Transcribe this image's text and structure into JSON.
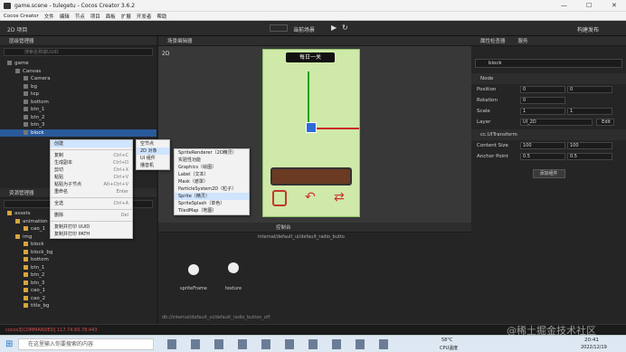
{
  "window": {
    "title": "game.scene - tulegetu - Cocos Creator 3.6.2"
  },
  "menubar": [
    "Cocos Creator",
    "文件",
    "编辑",
    "节点",
    "项目",
    "面板",
    "扩展",
    "开发者",
    "帮助"
  ],
  "toolbar": {
    "mode": "2D 项目",
    "scene_select": "当前场景",
    "build": "构建发布"
  },
  "hierarchy": {
    "title": "层级管理器",
    "search_placeholder": "搜索名称或UUID",
    "items": [
      {
        "label": "game",
        "d": 0
      },
      {
        "label": "Canvas",
        "d": 1
      },
      {
        "label": "Camera",
        "d": 2
      },
      {
        "label": "bg",
        "d": 2
      },
      {
        "label": "top",
        "d": 2
      },
      {
        "label": "bottom",
        "d": 2
      },
      {
        "label": "btn_1",
        "d": 2
      },
      {
        "label": "btn_2",
        "d": 2
      },
      {
        "label": "btn_3",
        "d": 2
      },
      {
        "label": "block",
        "d": 2,
        "selected": true
      }
    ]
  },
  "scene_editor": {
    "title": "场景编辑器",
    "mode": "2D",
    "header_text": "每日一关"
  },
  "assets": {
    "title": "资源管理器",
    "items": [
      {
        "label": "assets",
        "d": 0
      },
      {
        "label": "animation",
        "d": 1
      },
      {
        "label": "cao_1",
        "d": 2
      },
      {
        "label": "img",
        "d": 1
      },
      {
        "label": "block",
        "d": 2
      },
      {
        "label": "block_bg",
        "d": 2
      },
      {
        "label": "bottom",
        "d": 2
      },
      {
        "label": "btn_1",
        "d": 2
      },
      {
        "label": "btn_2",
        "d": 2
      },
      {
        "label": "btn_3",
        "d": 2
      },
      {
        "label": "cao_1",
        "d": 2
      },
      {
        "label": "cao_2",
        "d": 2
      },
      {
        "label": "title_bg",
        "d": 2
      }
    ]
  },
  "context_menu": {
    "items": [
      {
        "label": "创建",
        "key": ""
      },
      {
        "sep": true
      },
      {
        "label": "复制",
        "key": "Ctrl+C"
      },
      {
        "label": "生成副本",
        "key": "Ctrl+D"
      },
      {
        "label": "剪切",
        "key": "Ctrl+X"
      },
      {
        "label": "粘贴",
        "key": "Ctrl+V"
      },
      {
        "label": "粘贴为子节点",
        "key": "Alt+Ctrl+V"
      },
      {
        "label": "重命名",
        "key": "Enter"
      },
      {
        "sep": true
      },
      {
        "label": "全选",
        "key": "Ctrl+A"
      },
      {
        "sep": true
      },
      {
        "label": "删除",
        "key": "Del"
      },
      {
        "sep": true
      },
      {
        "label": "复制并打印 UUID",
        "key": ""
      },
      {
        "label": "复制并打印 PATH",
        "key": ""
      }
    ]
  },
  "submenu1": [
    "空节点",
    "2D 对象",
    "UI 组件",
    "播音机"
  ],
  "submenu2": [
    "SpriteRenderer（2D精灵）",
    "实验性功能",
    "Graphics（绘图）",
    "Label（文本）",
    "Mask（遮罩）",
    "ParticleSystem2D（粒子）",
    "Sprite（精灵）",
    "SpriteSplash（单色）",
    "TiledMap（地图）"
  ],
  "bottom_panel": {
    "path": "internal/default_ui/default_radio_butto",
    "tab": "控制台",
    "item1": "spriteFrame",
    "item2": "texture",
    "footer": "db://internal/default_ui/default_radio_button_off"
  },
  "inspector": {
    "title": "属性检查器",
    "tab2": "服务",
    "node_name": "block",
    "section_node": "Node",
    "position": {
      "label": "Position",
      "x": "0",
      "y": "0"
    },
    "rotation": {
      "label": "Rotation",
      "v": "0"
    },
    "scale": {
      "label": "Scale",
      "x": "1",
      "y": "1"
    },
    "layer": {
      "label": "Layer",
      "v": "UI_2D",
      "btn": "Edit"
    },
    "section_ui": "cc.UITransform",
    "content_size": {
      "label": "Content Size",
      "w": "100",
      "h": "100"
    },
    "anchor": {
      "label": "Anchor Point",
      "x": "0.5",
      "y": "0.5"
    },
    "add_component": "添加组件"
  },
  "status": {
    "text": "cocos3[COMMANDED] 117.74.60.78:443"
  },
  "taskbar": {
    "search": "在这里输入你要搜索的内容",
    "weather": "58°C",
    "weather2": "CPU温度",
    "time": "20:41",
    "date": "2022/12/19",
    "watermark": "@稀土掘金技术社区"
  }
}
